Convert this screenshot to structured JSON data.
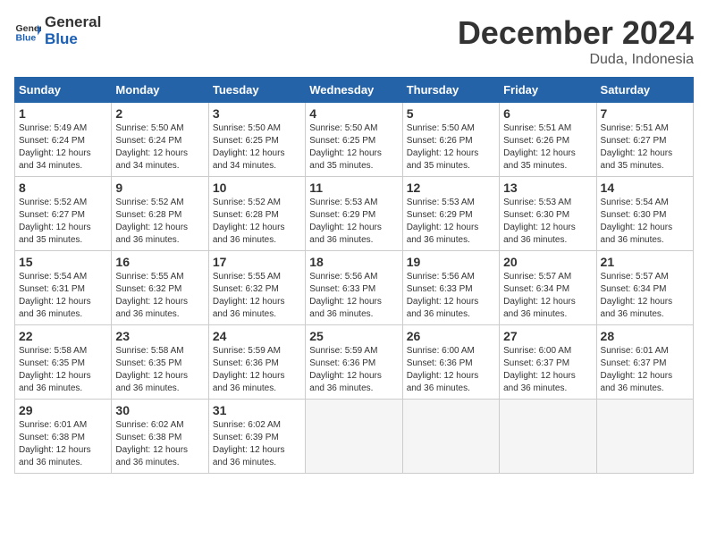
{
  "header": {
    "logo_general": "General",
    "logo_blue": "Blue",
    "month_year": "December 2024",
    "location": "Duda, Indonesia"
  },
  "days_of_week": [
    "Sunday",
    "Monday",
    "Tuesday",
    "Wednesday",
    "Thursday",
    "Friday",
    "Saturday"
  ],
  "weeks": [
    [
      {
        "day": "1",
        "sunrise": "5:49 AM",
        "sunset": "6:24 PM",
        "daylight": "12 hours and 34 minutes."
      },
      {
        "day": "2",
        "sunrise": "5:50 AM",
        "sunset": "6:24 PM",
        "daylight": "12 hours and 34 minutes."
      },
      {
        "day": "3",
        "sunrise": "5:50 AM",
        "sunset": "6:25 PM",
        "daylight": "12 hours and 34 minutes."
      },
      {
        "day": "4",
        "sunrise": "5:50 AM",
        "sunset": "6:25 PM",
        "daylight": "12 hours and 35 minutes."
      },
      {
        "day": "5",
        "sunrise": "5:50 AM",
        "sunset": "6:26 PM",
        "daylight": "12 hours and 35 minutes."
      },
      {
        "day": "6",
        "sunrise": "5:51 AM",
        "sunset": "6:26 PM",
        "daylight": "12 hours and 35 minutes."
      },
      {
        "day": "7",
        "sunrise": "5:51 AM",
        "sunset": "6:27 PM",
        "daylight": "12 hours and 35 minutes."
      }
    ],
    [
      {
        "day": "8",
        "sunrise": "5:52 AM",
        "sunset": "6:27 PM",
        "daylight": "12 hours and 35 minutes."
      },
      {
        "day": "9",
        "sunrise": "5:52 AM",
        "sunset": "6:28 PM",
        "daylight": "12 hours and 36 minutes."
      },
      {
        "day": "10",
        "sunrise": "5:52 AM",
        "sunset": "6:28 PM",
        "daylight": "12 hours and 36 minutes."
      },
      {
        "day": "11",
        "sunrise": "5:53 AM",
        "sunset": "6:29 PM",
        "daylight": "12 hours and 36 minutes."
      },
      {
        "day": "12",
        "sunrise": "5:53 AM",
        "sunset": "6:29 PM",
        "daylight": "12 hours and 36 minutes."
      },
      {
        "day": "13",
        "sunrise": "5:53 AM",
        "sunset": "6:30 PM",
        "daylight": "12 hours and 36 minutes."
      },
      {
        "day": "14",
        "sunrise": "5:54 AM",
        "sunset": "6:30 PM",
        "daylight": "12 hours and 36 minutes."
      }
    ],
    [
      {
        "day": "15",
        "sunrise": "5:54 AM",
        "sunset": "6:31 PM",
        "daylight": "12 hours and 36 minutes."
      },
      {
        "day": "16",
        "sunrise": "5:55 AM",
        "sunset": "6:32 PM",
        "daylight": "12 hours and 36 minutes."
      },
      {
        "day": "17",
        "sunrise": "5:55 AM",
        "sunset": "6:32 PM",
        "daylight": "12 hours and 36 minutes."
      },
      {
        "day": "18",
        "sunrise": "5:56 AM",
        "sunset": "6:33 PM",
        "daylight": "12 hours and 36 minutes."
      },
      {
        "day": "19",
        "sunrise": "5:56 AM",
        "sunset": "6:33 PM",
        "daylight": "12 hours and 36 minutes."
      },
      {
        "day": "20",
        "sunrise": "5:57 AM",
        "sunset": "6:34 PM",
        "daylight": "12 hours and 36 minutes."
      },
      {
        "day": "21",
        "sunrise": "5:57 AM",
        "sunset": "6:34 PM",
        "daylight": "12 hours and 36 minutes."
      }
    ],
    [
      {
        "day": "22",
        "sunrise": "5:58 AM",
        "sunset": "6:35 PM",
        "daylight": "12 hours and 36 minutes."
      },
      {
        "day": "23",
        "sunrise": "5:58 AM",
        "sunset": "6:35 PM",
        "daylight": "12 hours and 36 minutes."
      },
      {
        "day": "24",
        "sunrise": "5:59 AM",
        "sunset": "6:36 PM",
        "daylight": "12 hours and 36 minutes."
      },
      {
        "day": "25",
        "sunrise": "5:59 AM",
        "sunset": "6:36 PM",
        "daylight": "12 hours and 36 minutes."
      },
      {
        "day": "26",
        "sunrise": "6:00 AM",
        "sunset": "6:36 PM",
        "daylight": "12 hours and 36 minutes."
      },
      {
        "day": "27",
        "sunrise": "6:00 AM",
        "sunset": "6:37 PM",
        "daylight": "12 hours and 36 minutes."
      },
      {
        "day": "28",
        "sunrise": "6:01 AM",
        "sunset": "6:37 PM",
        "daylight": "12 hours and 36 minutes."
      }
    ],
    [
      {
        "day": "29",
        "sunrise": "6:01 AM",
        "sunset": "6:38 PM",
        "daylight": "12 hours and 36 minutes."
      },
      {
        "day": "30",
        "sunrise": "6:02 AM",
        "sunset": "6:38 PM",
        "daylight": "12 hours and 36 minutes."
      },
      {
        "day": "31",
        "sunrise": "6:02 AM",
        "sunset": "6:39 PM",
        "daylight": "12 hours and 36 minutes."
      },
      null,
      null,
      null,
      null
    ]
  ],
  "labels": {
    "sunrise": "Sunrise:",
    "sunset": "Sunset:",
    "daylight": "Daylight:"
  }
}
